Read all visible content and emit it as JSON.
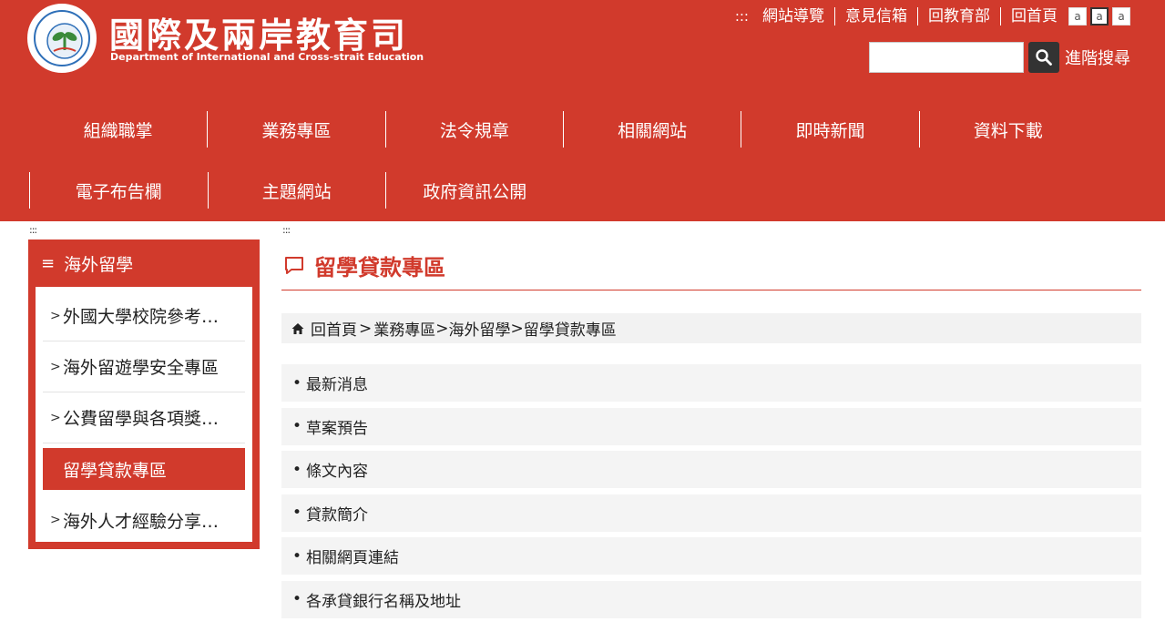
{
  "header": {
    "seal_text": "MINISTRY OF EDUCATION",
    "seal_bottom": "教育部",
    "title_zh": "國際及兩岸教育司",
    "title_en": "Department of International and Cross-strait Education",
    "top_links_lead": ":::",
    "top_links": [
      "網站導覽",
      "意見信箱",
      "回教育部",
      "回首頁"
    ],
    "font_sizes": [
      "a",
      "a",
      "a"
    ],
    "search_placeholder": "",
    "advanced_search": "進階搜尋",
    "colors": {
      "brand": "#d13a2c",
      "dark": "#333333"
    }
  },
  "nav": {
    "row1": [
      "組織職掌",
      "業務專區",
      "法令規章",
      "相關網站",
      "即時新聞",
      "資料下載"
    ],
    "row2": [
      "電子布告欄",
      "主題網站",
      "政府資訊公開"
    ]
  },
  "accessibility": {
    "left_marker": ":::",
    "main_marker": ":::"
  },
  "sidebar": {
    "title": "海外留學",
    "items": [
      {
        "label": "外國大學校院參考…"
      },
      {
        "label": "海外留遊學安全專區"
      },
      {
        "label": "公費留學與各項獎…"
      },
      {
        "label": "留學貸款專區"
      },
      {
        "label": "海外人才經驗分享…"
      }
    ]
  },
  "main": {
    "title": "留學貸款專區",
    "breadcrumb": {
      "home": "回首頁",
      "parts": [
        " > ",
        "業務專區",
        "> ",
        "海外留學",
        "> ",
        "留學貸款專區"
      ]
    },
    "list": [
      "最新消息",
      "草案預告",
      "條文內容",
      "貸款簡介",
      "相關網頁連結",
      "各承貸銀行名稱及地址"
    ]
  }
}
